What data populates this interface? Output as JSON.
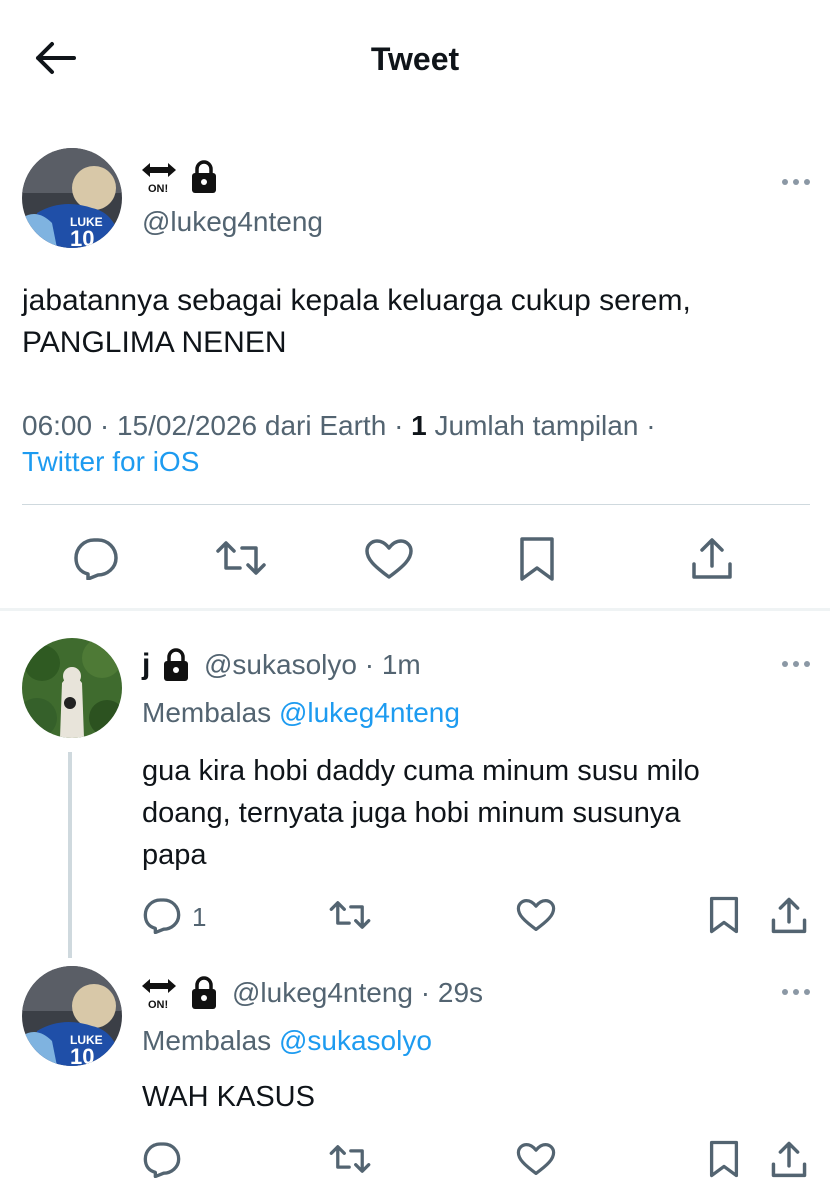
{
  "header": {
    "title": "Tweet"
  },
  "main_tweet": {
    "handle": "@lukeg4nteng",
    "text_line1": "jabatannya sebagai kepala keluarga cukup serem,",
    "text_line2": "PANGLIMA NENEN",
    "time": "06:00",
    "sep1": "·",
    "date": "15/02/2026 dari Earth",
    "sep2": "·",
    "views_count": "1",
    "views_label": "Jumlah tampilan",
    "sep3": "·",
    "source": "Twitter for iOS"
  },
  "reply1": {
    "name": "j",
    "handle": "@sukasolyo",
    "sep": "·",
    "time": "1m",
    "replying_prefix": "Membalas",
    "replying_to": "@lukeg4nteng",
    "text_line1": "gua kira hobi daddy cuma minum susu milo",
    "text_line2": "doang, ternyata juga hobi minum susunya",
    "text_line3": "papa",
    "reply_count": "1"
  },
  "reply2": {
    "handle": "@lukeg4nteng",
    "sep": "·",
    "time": "29s",
    "replying_prefix": "Membalas",
    "replying_to": "@sukasolyo",
    "text": "WAH KASUS"
  },
  "emoji": {
    "on_label": "ON!"
  },
  "colors": {
    "link": "#1d9bf0",
    "secondary": "#536471",
    "divider": "#cfd9de"
  }
}
